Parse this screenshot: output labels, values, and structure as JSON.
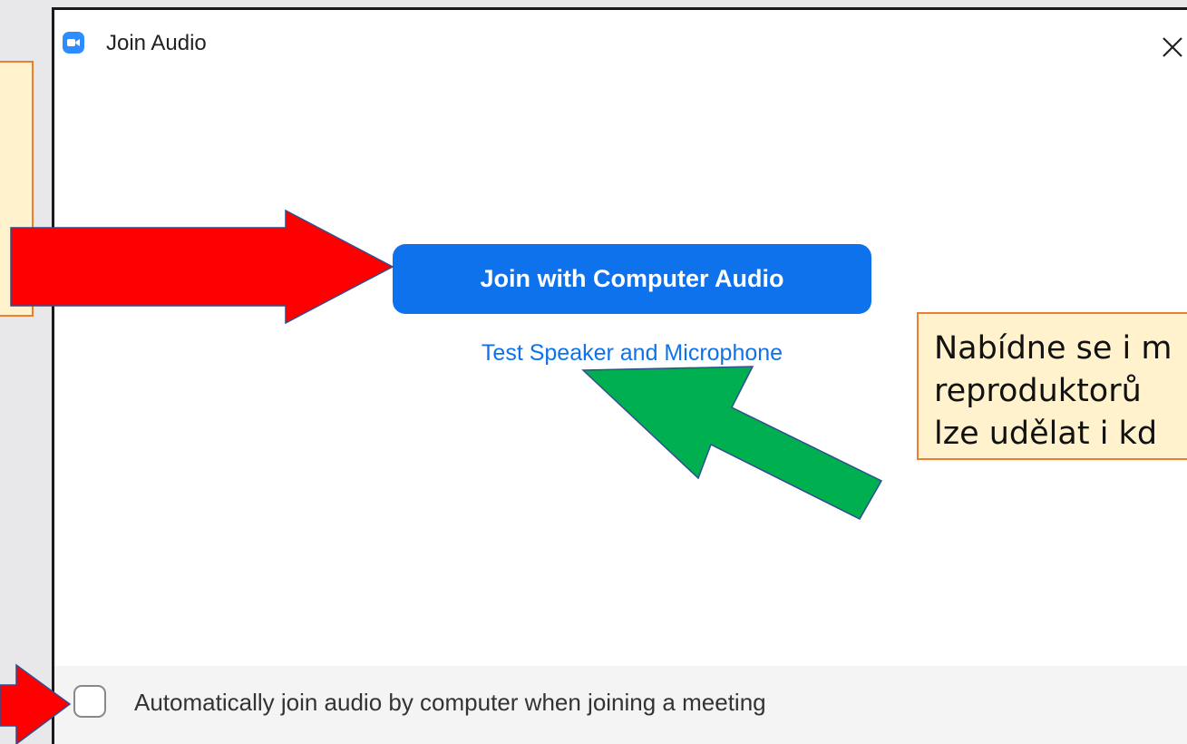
{
  "dialog": {
    "title": "Join Audio",
    "app_icon": "zoom-camera-icon",
    "close_icon": "close-icon"
  },
  "main": {
    "primary_button_label": "Join with Computer Audio",
    "test_link_label": "Test Speaker and Microphone"
  },
  "footer": {
    "checkbox_checked": false,
    "checkbox_label": "Automatically join audio by computer when joining a meeting"
  },
  "annotations": {
    "right_note_lines": [
      "Nabídne se i m",
      "reproduktorů",
      "lze udělat i kd"
    ],
    "arrow_colors": {
      "red": "#ff0000",
      "green": "#00b050",
      "callout_fill": "#fff2cc",
      "callout_border": "#ed7d31"
    }
  },
  "colors": {
    "accent": "#0e72ed",
    "zoom_blue": "#2d8cff"
  }
}
